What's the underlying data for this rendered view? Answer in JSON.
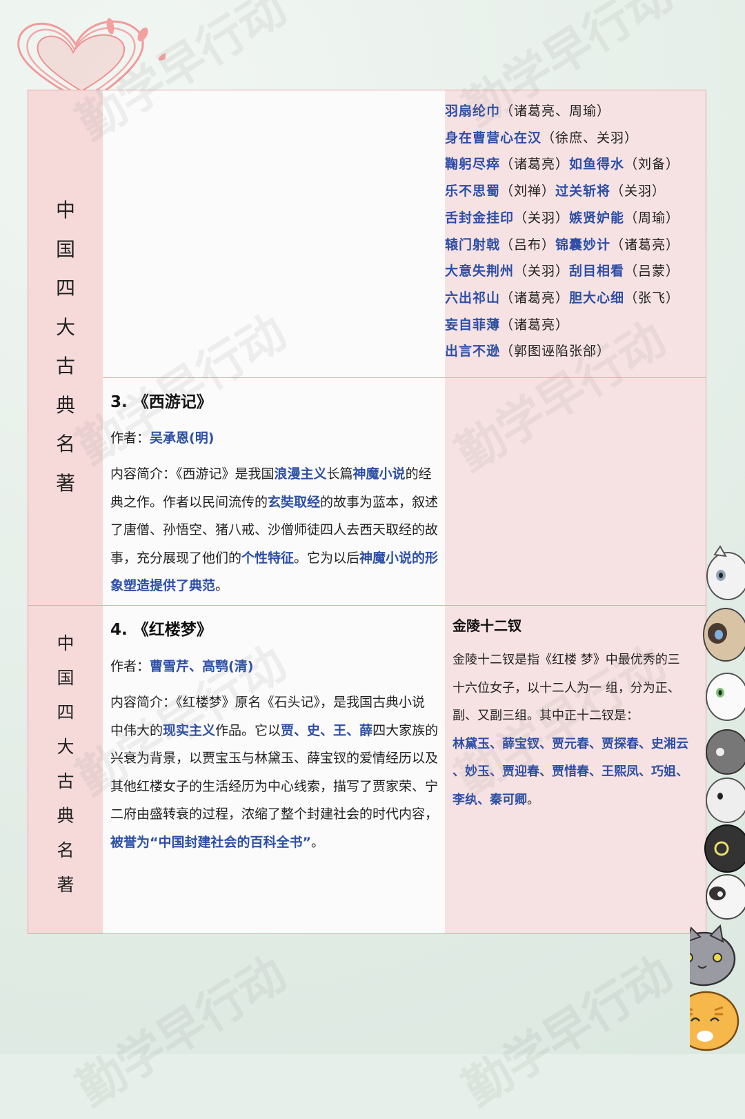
{
  "side_title": [
    "中",
    "国",
    "四",
    "大",
    "古",
    "典",
    "名",
    "著"
  ],
  "sanguo_list": [
    [
      {
        "t": "羽扇纶巾",
        "b": true
      },
      {
        "t": "（诸葛亮、周瑜）",
        "b": false
      }
    ],
    [
      {
        "t": "身在曹营心在汉",
        "b": true
      },
      {
        "t": "（徐庶、关羽）",
        "b": false
      }
    ],
    [
      {
        "t": "鞠躬尽瘁",
        "b": true
      },
      {
        "t": "（诸葛亮）",
        "b": false
      },
      {
        "t": "如鱼得水",
        "b": true
      },
      {
        "t": "（刘备）",
        "b": false
      }
    ],
    [
      {
        "t": "乐不思蜀",
        "b": true
      },
      {
        "t": "（刘禅）",
        "b": false
      },
      {
        "t": "过关斩将",
        "b": true
      },
      {
        "t": "（关羽）",
        "b": false
      }
    ],
    [
      {
        "t": "舌封金挂印",
        "b": true
      },
      {
        "t": "（关羽）",
        "b": false
      },
      {
        "t": "嫉贤妒能",
        "b": true
      },
      {
        "t": "（周瑜）",
        "b": false
      }
    ],
    [
      {
        "t": "辕门射戟",
        "b": true
      },
      {
        "t": "（吕布）",
        "b": false
      },
      {
        "t": "锦囊妙计",
        "b": true
      },
      {
        "t": "（诸葛亮）",
        "b": false
      }
    ],
    [
      {
        "t": "大意失荆州",
        "b": true
      },
      {
        "t": "（关羽）",
        "b": false
      },
      {
        "t": "刮目相看",
        "b": true
      },
      {
        "t": "（吕蒙）",
        "b": false
      }
    ],
    [
      {
        "t": "六出祁山",
        "b": true
      },
      {
        "t": "（诸葛亮）",
        "b": false
      },
      {
        "t": "胆大心细",
        "b": true
      },
      {
        "t": "（张飞）",
        "b": false
      }
    ],
    [
      {
        "t": "妄自菲薄",
        "b": true
      },
      {
        "t": "（诸葛亮）",
        "b": false
      }
    ],
    [
      {
        "t": "出言不逊",
        "b": true
      },
      {
        "t": "（郭图诬陷张郃）",
        "b": false
      }
    ]
  ],
  "xiyouji": {
    "title": "3. 《西游记》",
    "author_label": "作者：",
    "author": "吴承恩(明)",
    "intro": [
      [
        {
          "t": "内容简介：《西游记》是我国",
          "b": false
        },
        {
          "t": "浪漫主义",
          "b": true
        },
        {
          "t": "长篇",
          "b": false
        },
        {
          "t": "神魔小说",
          "b": true
        },
        {
          "t": "的经",
          "b": false
        }
      ],
      [
        {
          "t": "典之作。作者以民间流传的",
          "b": false
        },
        {
          "t": "玄奘取经",
          "b": true
        },
        {
          "t": "的故事为蓝本，叙述",
          "b": false
        }
      ],
      [
        {
          "t": "了唐僧、孙悟空、猪八戒、沙僧师徒四人去西天取经的故",
          "b": false
        }
      ],
      [
        {
          "t": "事，充分展现了他们的",
          "b": false
        },
        {
          "t": "个性特征",
          "b": true
        },
        {
          "t": "。它为以后",
          "b": false
        },
        {
          "t": "神魔小说的形",
          "b": true
        }
      ],
      [
        {
          "t": "象塑造提供了典范",
          "b": true
        },
        {
          "t": "。",
          "b": false
        }
      ]
    ]
  },
  "hongloumeng": {
    "title": "4. 《红楼梦》",
    "author_label": "作者：",
    "author": "曹雪芹、高鹗(清)",
    "intro": [
      [
        {
          "t": "内容简介：《红楼梦》原名《石头记》，是我国古典小说",
          "b": false
        }
      ],
      [
        {
          "t": "中伟大的",
          "b": false
        },
        {
          "t": "现实主义",
          "b": true
        },
        {
          "t": "作品。它以",
          "b": false
        },
        {
          "t": "贾、史、王、薛",
          "b": true
        },
        {
          "t": "四大家族的",
          "b": false
        }
      ],
      [
        {
          "t": "兴衰为背景，以贾宝玉与林黛玉、薛宝钗的爱情经历以及",
          "b": false
        }
      ],
      [
        {
          "t": "其他红楼女子的生活经历为中心线索，描写了贾家荣、宁",
          "b": false
        }
      ],
      [
        {
          "t": "二府由盛转衰的过程，浓缩了整个封建社会的时代内容，",
          "b": false
        }
      ],
      [
        {
          "t": "被誉为“中国封建社会的百科全书”",
          "b": true
        },
        {
          "t": "。",
          "b": false
        }
      ]
    ]
  },
  "jinling": {
    "title": "金陵十二钗",
    "intro": [
      [
        {
          "t": "金陵十二钗是指《红楼 梦》中最优秀的三",
          "b": false
        }
      ],
      [
        {
          "t": "十六位女子，以十二人为一 组，分为正、",
          "b": false
        }
      ],
      [
        {
          "t": "副、又副三组。其中正十二钗是：",
          "b": false
        }
      ],
      [
        {
          "t": "林黛玉、薛宝钗、贾元春、贾探春、史湘云",
          "b": true
        }
      ],
      [
        {
          "t": "、妙玉、贾迎春、贾惜春、王熙凤、巧姐、",
          "b": true
        }
      ],
      [
        {
          "t": "李纨、秦可卿",
          "b": true
        },
        {
          "t": "。",
          "b": false
        }
      ]
    ]
  },
  "watermark": "勤学早行动",
  "colors": {
    "accent_blue": "#2c4fa6",
    "pink_cell": "#f7e2e3",
    "border": "#e7a9a9"
  }
}
